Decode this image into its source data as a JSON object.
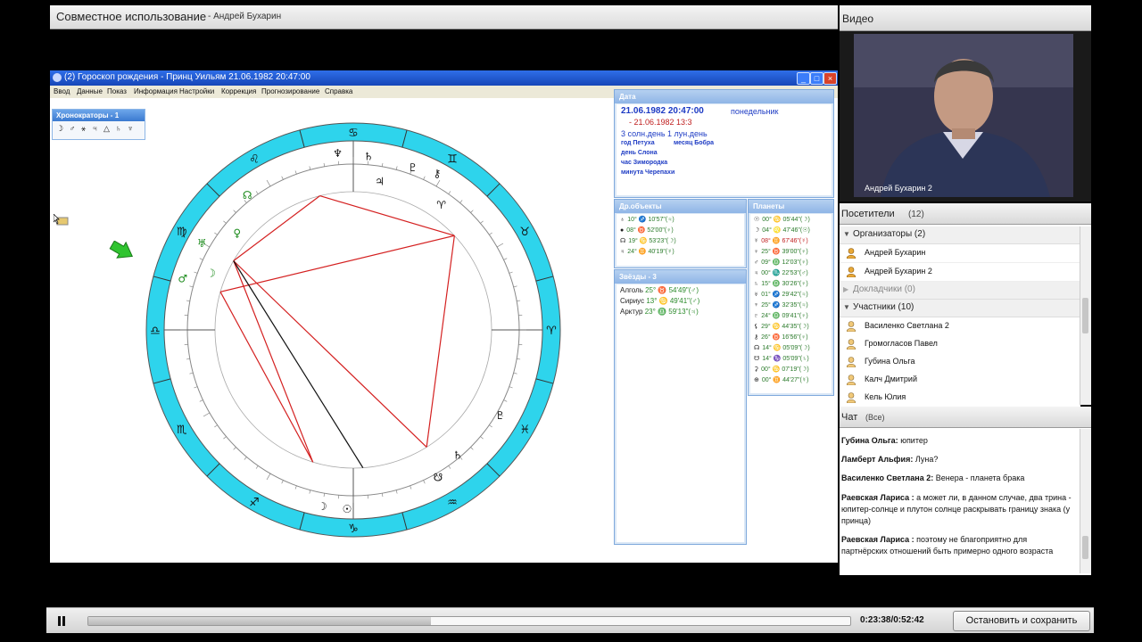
{
  "share": {
    "title": "Совместное использование",
    "presenter": "- Андрей Бухарин"
  },
  "astro_window": {
    "title": "(2) Гороскоп рождения - Принц Уильям 21.06.1982  20:47:00",
    "menu": [
      "Ввод",
      "Данные",
      "Показ",
      "Информация",
      "Настройки",
      "Коррекция",
      "Прогнозирование",
      "Справка"
    ],
    "chronocrators": {
      "title": "Хронократоры - 1",
      "icons": "☽ ♂ ⚹ ♃ △ ♄ ♆"
    },
    "date_panel": {
      "title": "Дата",
      "date_time": "21.06.1982  20:47:00",
      "weekday": "понедельник",
      "line2": "- 21.06.1982  13:3",
      "lunar": "3 солн.день  1 лун.день",
      "year": "год Петуха",
      "month": "месяц Бобра",
      "day": "день Слона",
      "hour": "час Зимородка",
      "minute": "минута Черепахи"
    },
    "other_objects": {
      "title": "Др.объекты",
      "rows": [
        {
          "glyph": "♁",
          "text": "10° ♐ 10'57\"(♃)"
        },
        {
          "glyph": "●",
          "text": "08° ♉ 52'00\"(♀)"
        },
        {
          "glyph": "☊",
          "text": "19° ♋ 53'23\"(☽)"
        },
        {
          "glyph": "♃",
          "text": "24° ♊ 40'19\"(☿)"
        }
      ]
    },
    "stars": {
      "title": "Звёзды - 3",
      "rows": [
        {
          "name": "Алголь",
          "pos": "25° ♉ 54'49\"(♂)"
        },
        {
          "name": "Сириус",
          "pos": "13° ♋ 49'41\"(♂)"
        },
        {
          "name": "Арктур",
          "pos": "23° ♎ 59'13\"(♃)"
        }
      ]
    },
    "planets": {
      "title": "Планеты",
      "rows": [
        {
          "glyph": "☉",
          "text": "00° ♋ 05'44\"(☽)"
        },
        {
          "glyph": "☽",
          "text": "04° ♌ 47'46\"(☉)"
        },
        {
          "glyph": "☿",
          "text": "08° ♊ 67'46\"(☿)"
        },
        {
          "glyph": "♀",
          "text": "25° ♉ 39'00\"(♀)"
        },
        {
          "glyph": "♂",
          "text": "09° ♎ 12'03\"(♀)"
        },
        {
          "glyph": "♃",
          "text": "00° ♏ 22'53\"(♂)"
        },
        {
          "glyph": "♄",
          "text": "15° ♎ 30'26\"(♀)"
        },
        {
          "glyph": "♅",
          "text": "01° ♐ 29'42\"(♃)"
        },
        {
          "glyph": "♆",
          "text": "25° ♐ 32'35\"(♃)"
        },
        {
          "glyph": "♇",
          "text": "24° ♎ 09'41\"(♀)"
        },
        {
          "glyph": "⚸",
          "text": "29° ♋ 44'35\"(☽)"
        },
        {
          "glyph": "⚷",
          "text": "26° ♉ 16'56\"(♀)"
        },
        {
          "glyph": "☊",
          "text": "14° ♋ 05'09\"(☽)"
        },
        {
          "glyph": "☋",
          "text": "14° ♑ 05'09\"(♄)"
        },
        {
          "glyph": "⚳",
          "text": "00° ♋ 07'19\"(☽)"
        },
        {
          "glyph": "⊕",
          "text": "00° ♊ 44'27\"(☿)"
        }
      ]
    }
  },
  "video": {
    "title": "Видео",
    "name": "Андрей Бухарин 2"
  },
  "attendees": {
    "title": "Посетители",
    "count": "(12)",
    "groups": {
      "organizers": "Организаторы (2)",
      "presenters": "Докладчики (0)",
      "participants": "Участники (10)"
    },
    "organizers": [
      "Андрей Бухарин",
      "Андрей Бухарин 2"
    ],
    "participants": [
      "Василенко Светлана 2",
      "Громогласов   Павел",
      "Губина Ольга",
      "Калч Дмитрий",
      "Кель Юлия"
    ]
  },
  "chat": {
    "title": "Чат",
    "scope": "(Все)",
    "messages": [
      {
        "author": "Губина Ольга:",
        "text": " юпитер"
      },
      {
        "author": "Ламберт  Альфия:",
        "text": " Луна?"
      },
      {
        "author": "Василенко Светлана 2:",
        "text": " Венера - планета брака"
      },
      {
        "author": "Раевская   Лариса :",
        "text": " а может ли, в данном случае, два трина - юпитер-солнце и плутон солнце раскрывать границу знака (у принца)"
      },
      {
        "author": "Раевская   Лариса :",
        "text": " поэтому не благоприятно для партнёрских отношений быть примерно одного возраста"
      }
    ]
  },
  "playback": {
    "time": "0:23:38/0:52:42",
    "progress": 0.45,
    "stop_label": "Остановить и сохранить"
  },
  "colors": {
    "zodiac_ring": "#2ed4ec",
    "aspect_red": "#d42020",
    "aspect_black": "#111111",
    "panel_blue": "#2a4bd0"
  }
}
